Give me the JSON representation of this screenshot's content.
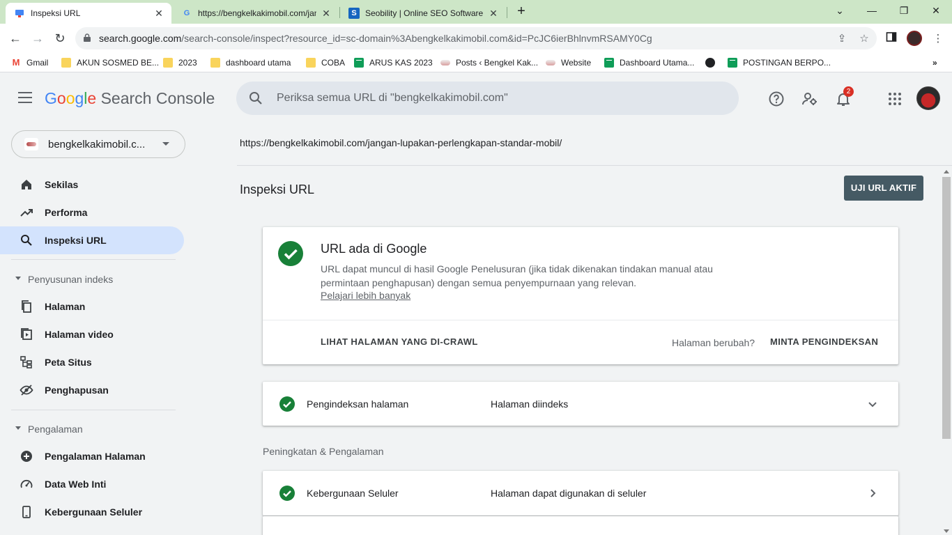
{
  "browser": {
    "tabs": [
      {
        "title": "Inspeksi URL",
        "active": true
      },
      {
        "title": "https://bengkelkakimobil.com/jan"
      },
      {
        "title": "Seobility | Online SEO Software &"
      }
    ],
    "url_domain": "search.google.com",
    "url_path": "/search-console/inspect?resource_id=sc-domain%3Abengkelkakimobil.com&id=PcJC6ierBhlnvmRSAMY0Cg",
    "bookmarks": [
      {
        "label": "Gmail",
        "icon": "gmail-icon"
      },
      {
        "label": "AKUN SOSMED BE...",
        "icon": "folder-icon"
      },
      {
        "label": "2023",
        "icon": "folder-icon"
      },
      {
        "label": "dashboard utama",
        "icon": "folder-icon"
      },
      {
        "label": "COBA",
        "icon": "folder-icon"
      },
      {
        "label": "ARUS KAS 2023",
        "icon": "sheets-icon"
      },
      {
        "label": "Posts ‹ Bengkel Kak...",
        "icon": "car-icon"
      },
      {
        "label": "Website",
        "icon": "car-icon"
      },
      {
        "label": "Dashboard Utama...",
        "icon": "sheets-icon"
      },
      {
        "label": "",
        "icon": "globe-icon"
      },
      {
        "label": "POSTINGAN BERPO...",
        "icon": "sheets-icon"
      }
    ]
  },
  "header": {
    "logo": {
      "g1": "G",
      "g2": "o",
      "g3": "o",
      "g4": "g",
      "g5": "l",
      "g6": "e",
      "product": "Search Console"
    },
    "search_placeholder": "Periksa semua URL di \"bengkelkakimobil.com\"",
    "notification_count": "2"
  },
  "sidebar": {
    "property": "bengkelkakimobil.c...",
    "top_items": [
      {
        "label": "Sekilas",
        "icon": "home-icon"
      },
      {
        "label": "Performa",
        "icon": "trending-icon"
      },
      {
        "label": "Inspeksi URL",
        "icon": "search-icon",
        "active": true
      }
    ],
    "sections": [
      {
        "title": "Penyusunan indeks",
        "items": [
          {
            "label": "Halaman",
            "icon": "pages-icon"
          },
          {
            "label": "Halaman video",
            "icon": "video-page-icon"
          },
          {
            "label": "Peta Situs",
            "icon": "sitemap-icon"
          },
          {
            "label": "Penghapusan",
            "icon": "removal-icon"
          }
        ]
      },
      {
        "title": "Pengalaman",
        "items": [
          {
            "label": "Pengalaman Halaman",
            "icon": "plus-circle-icon"
          },
          {
            "label": "Data Web Inti",
            "icon": "gauge-icon"
          },
          {
            "label": "Kebergunaan Seluler",
            "icon": "phone-icon"
          }
        ]
      }
    ]
  },
  "main": {
    "inspected_url": "https://bengkelkakimobil.com/jangan-lupakan-perlengkapan-standar-mobil/",
    "title": "Inspeksi URL",
    "live_test_button": "UJI URL AKTIF",
    "status_card": {
      "title": "URL ada di Google",
      "description": "URL dapat muncul di hasil Google Penelusuran (jika tidak dikenakan tindakan manual atau permintaan penghapusan) dengan semua penyempurnaan yang relevan.",
      "learn_more": "Pelajari lebih banyak",
      "view_crawled": "LIHAT HALAMAN YANG DI-CRAWL",
      "page_changed": "Halaman berubah?",
      "request_indexing": "MINTA PENGINDEKSAN"
    },
    "indexing_row": {
      "label": "Pengindeksan halaman",
      "value": "Halaman diindeks"
    },
    "enhancements_caption": "Peningkatan & Pengalaman",
    "mobile_row": {
      "label": "Kebergunaan Seluler",
      "value": "Halaman dapat digunakan di seluler"
    }
  },
  "colors": {
    "success_green": "#188038",
    "active_nav": "#d3e3fd",
    "primary_button": "#455a64",
    "tab_strip": "#cde6c7"
  }
}
